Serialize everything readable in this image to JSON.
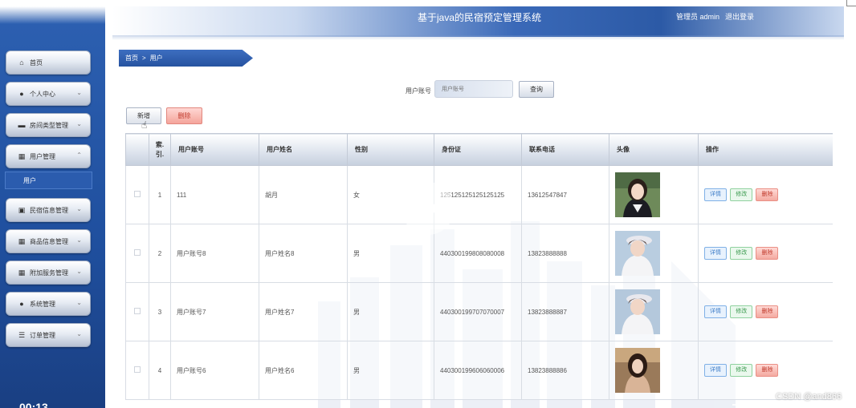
{
  "header": {
    "app_title": "基于java的民宿预定管理系统",
    "admin_label": "管理员 admin",
    "logout": "退出登录"
  },
  "sidebar": {
    "items": [
      {
        "label": "首页",
        "icon": "home-icon",
        "chevron": ""
      },
      {
        "label": "个人中心",
        "icon": "person-icon",
        "chevron": "⌄"
      },
      {
        "label": "房间类型管理",
        "icon": "bed-icon",
        "chevron": "⌄"
      },
      {
        "label": "用户管理",
        "icon": "grid-icon",
        "chevron": "⌃"
      },
      {
        "label": "民宿信息管理",
        "icon": "building-icon",
        "chevron": "⌄"
      },
      {
        "label": "商品信息管理",
        "icon": "grid-icon",
        "chevron": "⌄"
      },
      {
        "label": "附加服务管理",
        "icon": "grid-icon",
        "chevron": "⌄"
      },
      {
        "label": "系统管理",
        "icon": "person-icon",
        "chevron": "⌄"
      },
      {
        "label": "订单管理",
        "icon": "list-icon",
        "chevron": "⌄"
      }
    ],
    "submenu_label": "用户",
    "time": "00:13"
  },
  "breadcrumb": {
    "home": "首页",
    "sep": ">",
    "current": "用户"
  },
  "search": {
    "label": "用户账号",
    "placeholder": "用户账号",
    "button": "查询"
  },
  "actions": {
    "add": "新增",
    "delete": "删除"
  },
  "table": {
    "headers": [
      "",
      "索引",
      "用户账号",
      "用户姓名",
      "性别",
      "身份证",
      "联系电话",
      "头像",
      "操作"
    ],
    "index_header_top": "索",
    "index_header_bottom": "引",
    "rows": [
      {
        "index": "1",
        "account": "111",
        "name": "胡月",
        "gender": "女",
        "id_card": "125125125125125125",
        "phone": "13612547847"
      },
      {
        "index": "2",
        "account": "用户账号8",
        "name": "用户姓名8",
        "gender": "男",
        "id_card": "440300199808080008",
        "phone": "13823888888"
      },
      {
        "index": "3",
        "account": "用户账号7",
        "name": "用户姓名7",
        "gender": "男",
        "id_card": "440300199707070007",
        "phone": "13823888887"
      },
      {
        "index": "4",
        "account": "用户账号6",
        "name": "用户姓名6",
        "gender": "男",
        "id_card": "440300199606060006",
        "phone": "13823888886"
      }
    ],
    "ops": {
      "detail": "详情",
      "edit": "修改",
      "delete": "删除"
    }
  },
  "watermark": "CSDN @and866",
  "colors": {
    "sidebar_blue": "#1f4f9e",
    "header_blue": "#2c5aa6",
    "danger": "#f4a49b"
  }
}
